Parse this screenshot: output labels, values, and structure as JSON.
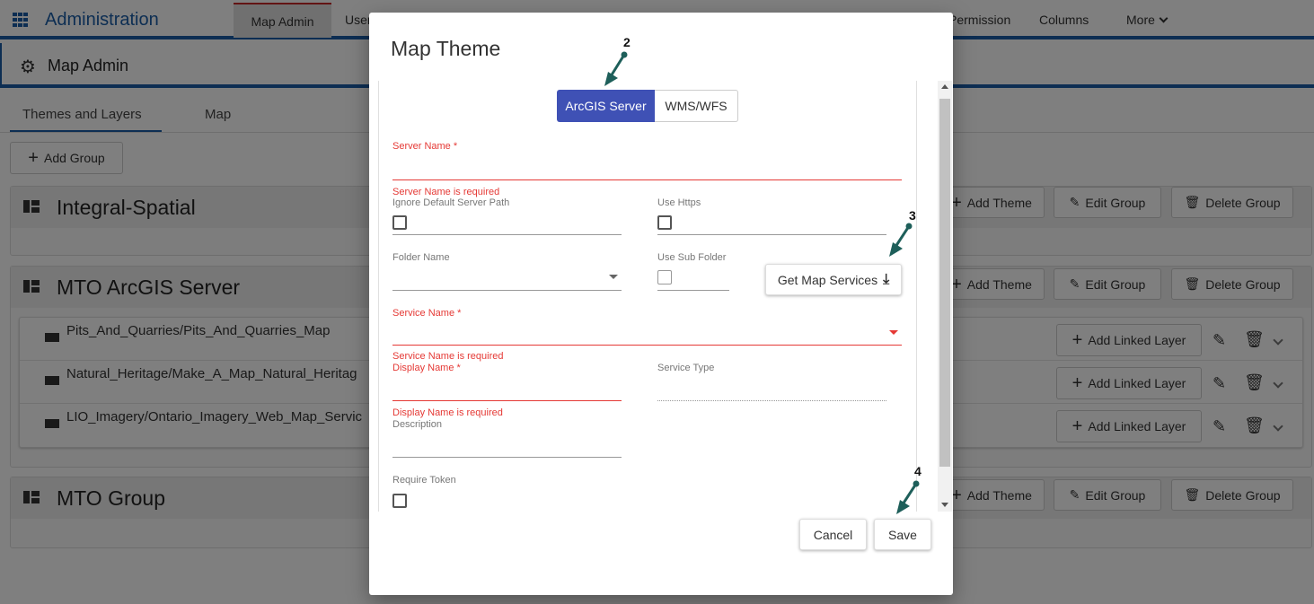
{
  "app": {
    "title": "Administration",
    "nav": [
      "Map Admin",
      "User",
      "Permission",
      "Columns",
      "More"
    ]
  },
  "page": {
    "title": "Map Admin",
    "tabs": [
      "Themes and Layers",
      "Map"
    ],
    "add_group_label": "Add Group"
  },
  "groups": [
    {
      "title": "Integral-Spatial",
      "add_theme": "Add Theme",
      "edit_group": "Edit Group",
      "delete_group": "Delete Group"
    },
    {
      "title": "MTO ArcGIS Server",
      "add_theme": "Add Theme",
      "edit_group": "Edit Group",
      "delete_group": "Delete Group",
      "layers": [
        {
          "name": "Pits_And_Quarries/Pits_And_Quarries_Map",
          "add_linked_layer": "Add Linked Layer"
        },
        {
          "name": "Natural_Heritage/Make_A_Map_Natural_Heritag",
          "add_linked_layer": "Add Linked Layer"
        },
        {
          "name": "LIO_Imagery/Ontario_Imagery_Web_Map_Servic",
          "add_linked_layer": "Add Linked Layer"
        }
      ]
    },
    {
      "title": "MTO Group",
      "add_theme": "Add Theme",
      "edit_group": "Edit Group",
      "delete_group": "Delete Group"
    }
  ],
  "modal": {
    "title": "Map Theme",
    "source_toggle": {
      "options": [
        "ArcGIS Server",
        "WMS/WFS"
      ],
      "selected": "ArcGIS Server"
    },
    "fields": {
      "server_name": {
        "label": "Server Name *",
        "value": "",
        "error": "Server Name is required"
      },
      "ignore_default_path": {
        "label": "Ignore Default Server Path",
        "checked": false
      },
      "use_https": {
        "label": "Use Https",
        "checked": false
      },
      "folder_name": {
        "label": "Folder Name",
        "value": ""
      },
      "use_sub_folder": {
        "label": "Use Sub Folder",
        "checked": false
      },
      "service_name": {
        "label": "Service Name *",
        "value": "",
        "error": "Service Name is required"
      },
      "display_name": {
        "label": "Display Name *",
        "value": "",
        "error": "Display Name is required"
      },
      "service_type": {
        "label": "Service Type",
        "value": ""
      },
      "description": {
        "label": "Description",
        "value": ""
      },
      "require_token": {
        "label": "Require Token",
        "checked": false
      }
    },
    "get_map_services_label": "Get Map Services",
    "cancel_label": "Cancel",
    "save_label": "Save"
  },
  "callouts": [
    "2",
    "3",
    "4"
  ],
  "colors": {
    "brand_blue": "#1a5da6",
    "toggle_active": "#3f51b5",
    "error_red": "#e53935",
    "callout_arrow": "#1e5f5a"
  }
}
